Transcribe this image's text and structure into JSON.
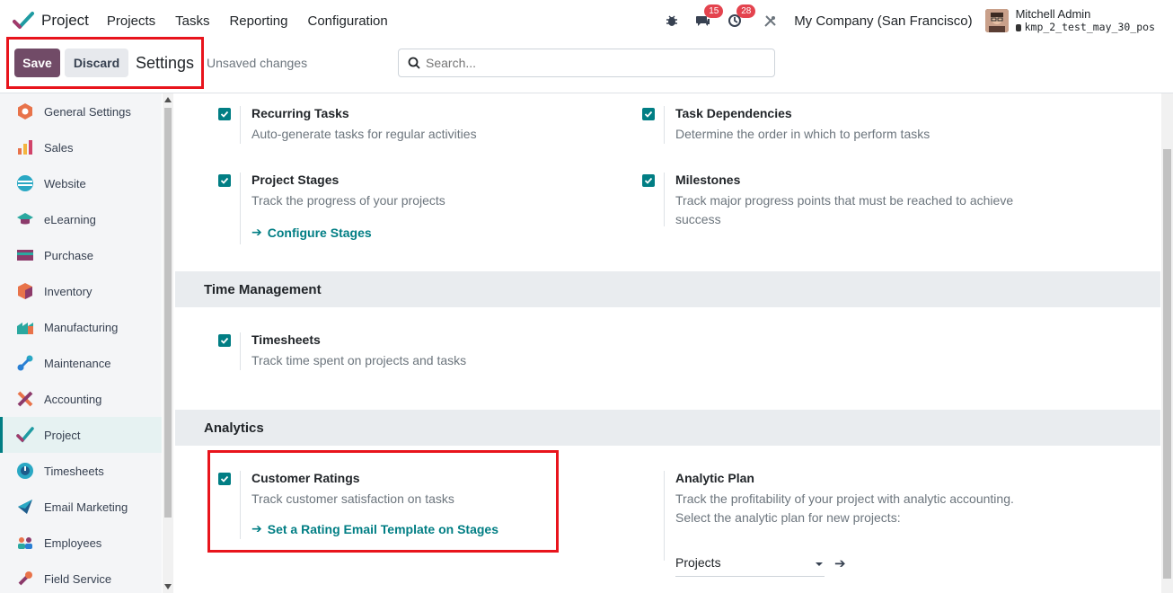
{
  "navbar": {
    "app_name": "Project",
    "menu": [
      "Projects",
      "Tasks",
      "Reporting",
      "Configuration"
    ],
    "messages_count": "15",
    "activities_count": "28",
    "company": "My Company (San Francisco)",
    "user_name": "Mitchell Admin",
    "database": "kmp_2_test_may_30_pos"
  },
  "control": {
    "save_label": "Save",
    "discard_label": "Discard",
    "title": "Settings",
    "unsaved": "Unsaved changes",
    "search_placeholder": "Search..."
  },
  "sidebar": {
    "items": [
      {
        "label": "General Settings",
        "icon": "general-settings-icon"
      },
      {
        "label": "Sales",
        "icon": "sales-icon"
      },
      {
        "label": "Website",
        "icon": "website-icon"
      },
      {
        "label": "eLearning",
        "icon": "elearning-icon"
      },
      {
        "label": "Purchase",
        "icon": "purchase-icon"
      },
      {
        "label": "Inventory",
        "icon": "inventory-icon"
      },
      {
        "label": "Manufacturing",
        "icon": "manufacturing-icon"
      },
      {
        "label": "Maintenance",
        "icon": "maintenance-icon"
      },
      {
        "label": "Accounting",
        "icon": "accounting-icon"
      },
      {
        "label": "Project",
        "icon": "project-icon"
      },
      {
        "label": "Timesheets",
        "icon": "timesheets-icon"
      },
      {
        "label": "Email Marketing",
        "icon": "email-marketing-icon"
      },
      {
        "label": "Employees",
        "icon": "employees-icon"
      },
      {
        "label": "Field Service",
        "icon": "field-service-icon"
      }
    ],
    "active": "Project"
  },
  "tasks_settings": {
    "recurring": {
      "title": "Recurring Tasks",
      "desc": "Auto-generate tasks for regular activities"
    },
    "dependencies": {
      "title": "Task Dependencies",
      "desc": "Determine the order in which to perform tasks"
    },
    "stages": {
      "title": "Project Stages",
      "desc": "Track the progress of your projects",
      "link": "Configure Stages"
    },
    "milestones": {
      "title": "Milestones",
      "desc_line1": "Track major progress points that must be reached to achieve",
      "desc_line2": "success"
    }
  },
  "time_management": {
    "heading": "Time Management",
    "timesheets": {
      "title": "Timesheets",
      "desc": "Track time spent on projects and tasks"
    }
  },
  "analytics": {
    "heading": "Analytics",
    "ratings": {
      "title": "Customer Ratings",
      "desc": "Track customer satisfaction on tasks",
      "link": "Set a Rating Email Template on Stages"
    },
    "analytic_plan": {
      "title": "Analytic Plan",
      "desc_line1": "Track the profitability of your project with analytic accounting.",
      "desc_line2": "Select the analytic plan for new projects:",
      "selected": "Projects"
    }
  },
  "colors": {
    "primary": "#714b67",
    "teal": "#017e84",
    "highlight": "#e8141c"
  }
}
